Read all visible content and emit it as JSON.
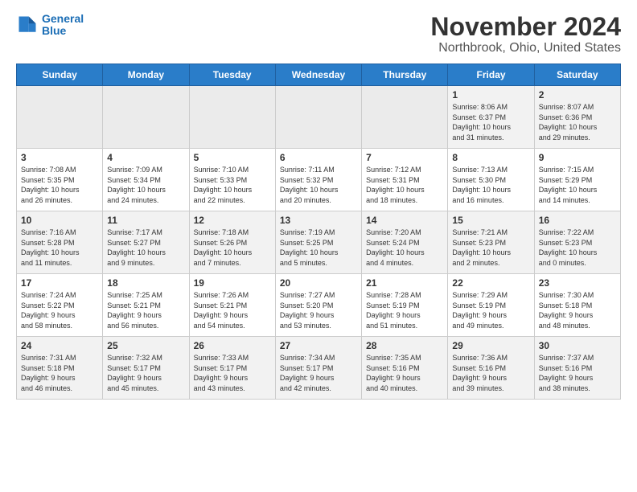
{
  "header": {
    "logo_line1": "General",
    "logo_line2": "Blue",
    "title": "November 2024",
    "subtitle": "Northbrook, Ohio, United States"
  },
  "days_of_week": [
    "Sunday",
    "Monday",
    "Tuesday",
    "Wednesday",
    "Thursday",
    "Friday",
    "Saturday"
  ],
  "weeks": [
    [
      {
        "num": "",
        "info": ""
      },
      {
        "num": "",
        "info": ""
      },
      {
        "num": "",
        "info": ""
      },
      {
        "num": "",
        "info": ""
      },
      {
        "num": "",
        "info": ""
      },
      {
        "num": "1",
        "info": "Sunrise: 8:06 AM\nSunset: 6:37 PM\nDaylight: 10 hours\nand 31 minutes."
      },
      {
        "num": "2",
        "info": "Sunrise: 8:07 AM\nSunset: 6:36 PM\nDaylight: 10 hours\nand 29 minutes."
      }
    ],
    [
      {
        "num": "3",
        "info": "Sunrise: 7:08 AM\nSunset: 5:35 PM\nDaylight: 10 hours\nand 26 minutes."
      },
      {
        "num": "4",
        "info": "Sunrise: 7:09 AM\nSunset: 5:34 PM\nDaylight: 10 hours\nand 24 minutes."
      },
      {
        "num": "5",
        "info": "Sunrise: 7:10 AM\nSunset: 5:33 PM\nDaylight: 10 hours\nand 22 minutes."
      },
      {
        "num": "6",
        "info": "Sunrise: 7:11 AM\nSunset: 5:32 PM\nDaylight: 10 hours\nand 20 minutes."
      },
      {
        "num": "7",
        "info": "Sunrise: 7:12 AM\nSunset: 5:31 PM\nDaylight: 10 hours\nand 18 minutes."
      },
      {
        "num": "8",
        "info": "Sunrise: 7:13 AM\nSunset: 5:30 PM\nDaylight: 10 hours\nand 16 minutes."
      },
      {
        "num": "9",
        "info": "Sunrise: 7:15 AM\nSunset: 5:29 PM\nDaylight: 10 hours\nand 14 minutes."
      }
    ],
    [
      {
        "num": "10",
        "info": "Sunrise: 7:16 AM\nSunset: 5:28 PM\nDaylight: 10 hours\nand 11 minutes."
      },
      {
        "num": "11",
        "info": "Sunrise: 7:17 AM\nSunset: 5:27 PM\nDaylight: 10 hours\nand 9 minutes."
      },
      {
        "num": "12",
        "info": "Sunrise: 7:18 AM\nSunset: 5:26 PM\nDaylight: 10 hours\nand 7 minutes."
      },
      {
        "num": "13",
        "info": "Sunrise: 7:19 AM\nSunset: 5:25 PM\nDaylight: 10 hours\nand 5 minutes."
      },
      {
        "num": "14",
        "info": "Sunrise: 7:20 AM\nSunset: 5:24 PM\nDaylight: 10 hours\nand 4 minutes."
      },
      {
        "num": "15",
        "info": "Sunrise: 7:21 AM\nSunset: 5:23 PM\nDaylight: 10 hours\nand 2 minutes."
      },
      {
        "num": "16",
        "info": "Sunrise: 7:22 AM\nSunset: 5:23 PM\nDaylight: 10 hours\nand 0 minutes."
      }
    ],
    [
      {
        "num": "17",
        "info": "Sunrise: 7:24 AM\nSunset: 5:22 PM\nDaylight: 9 hours\nand 58 minutes."
      },
      {
        "num": "18",
        "info": "Sunrise: 7:25 AM\nSunset: 5:21 PM\nDaylight: 9 hours\nand 56 minutes."
      },
      {
        "num": "19",
        "info": "Sunrise: 7:26 AM\nSunset: 5:21 PM\nDaylight: 9 hours\nand 54 minutes."
      },
      {
        "num": "20",
        "info": "Sunrise: 7:27 AM\nSunset: 5:20 PM\nDaylight: 9 hours\nand 53 minutes."
      },
      {
        "num": "21",
        "info": "Sunrise: 7:28 AM\nSunset: 5:19 PM\nDaylight: 9 hours\nand 51 minutes."
      },
      {
        "num": "22",
        "info": "Sunrise: 7:29 AM\nSunset: 5:19 PM\nDaylight: 9 hours\nand 49 minutes."
      },
      {
        "num": "23",
        "info": "Sunrise: 7:30 AM\nSunset: 5:18 PM\nDaylight: 9 hours\nand 48 minutes."
      }
    ],
    [
      {
        "num": "24",
        "info": "Sunrise: 7:31 AM\nSunset: 5:18 PM\nDaylight: 9 hours\nand 46 minutes."
      },
      {
        "num": "25",
        "info": "Sunrise: 7:32 AM\nSunset: 5:17 PM\nDaylight: 9 hours\nand 45 minutes."
      },
      {
        "num": "26",
        "info": "Sunrise: 7:33 AM\nSunset: 5:17 PM\nDaylight: 9 hours\nand 43 minutes."
      },
      {
        "num": "27",
        "info": "Sunrise: 7:34 AM\nSunset: 5:17 PM\nDaylight: 9 hours\nand 42 minutes."
      },
      {
        "num": "28",
        "info": "Sunrise: 7:35 AM\nSunset: 5:16 PM\nDaylight: 9 hours\nand 40 minutes."
      },
      {
        "num": "29",
        "info": "Sunrise: 7:36 AM\nSunset: 5:16 PM\nDaylight: 9 hours\nand 39 minutes."
      },
      {
        "num": "30",
        "info": "Sunrise: 7:37 AM\nSunset: 5:16 PM\nDaylight: 9 hours\nand 38 minutes."
      }
    ]
  ]
}
